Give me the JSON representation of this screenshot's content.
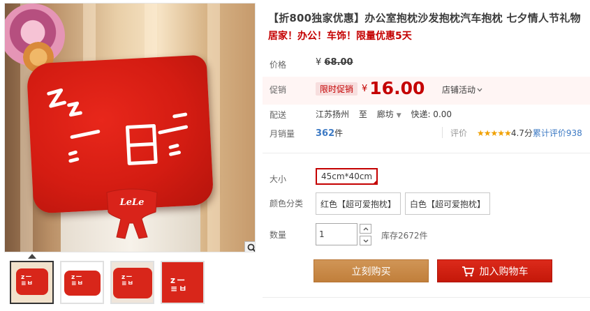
{
  "product": {
    "title": "【折800独家优惠】办公室抱枕沙发抱枕汽车抱枕 七夕情人节礼物",
    "subtitle": "居家！办公！车饰！限量优惠5天"
  },
  "gallery": {
    "doll_text": "LeLe",
    "zoom_icon": "magnifier-icon",
    "thumb_count": 4
  },
  "price": {
    "label": "价格",
    "currency": "¥",
    "original": "68.00"
  },
  "promotion": {
    "label": "促销",
    "tag": "限时促销",
    "currency": "¥",
    "price": "16.00",
    "shop_activity": "店铺活动"
  },
  "shipping": {
    "label": "配送",
    "from": "江苏扬州",
    "to_word": "至",
    "dest": "廊坊",
    "express": "快递: 0.00"
  },
  "sales": {
    "label": "月销量",
    "count": "362",
    "unit": "件",
    "review_label": "评价",
    "stars": "★★★★★",
    "score": "4.7分",
    "total_reviews": "累计评价938"
  },
  "size": {
    "label": "大小",
    "selected": "45cm*40cm"
  },
  "color": {
    "label": "颜色分类",
    "options": [
      "红色【超可爱抱枕】",
      "白色【超可爱抱枕】"
    ]
  },
  "quantity": {
    "label": "数量",
    "value": "1",
    "stock": "库存2672件"
  },
  "actions": {
    "buy_now": "立刻购买",
    "add_to_cart": "加入购物车"
  },
  "colors": {
    "brand_red": "#c40000",
    "buy_button": "#c8843f",
    "cart_button": "#d02010",
    "link_blue": "#3d7ac4",
    "star": "#f0a000"
  }
}
